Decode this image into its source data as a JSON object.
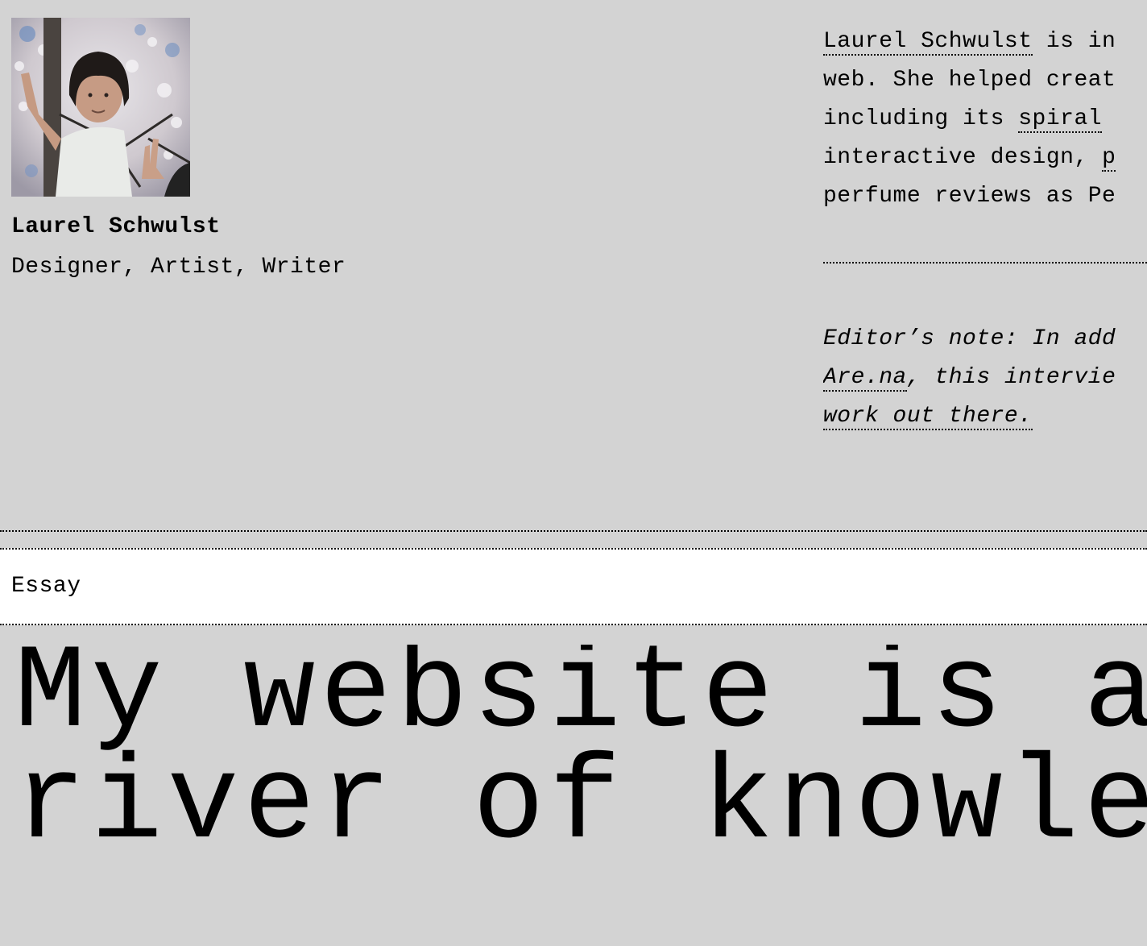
{
  "author": {
    "name": "Laurel Schwulst",
    "role": "Designer, Artist, Writer",
    "photo_alt": "Laurel Schwulst"
  },
  "bio": {
    "line1_link": "Laurel Schwulst",
    "line1_rest": " is in",
    "line2": "web. She helped creat",
    "line3_pre": "including its ",
    "line3_link": "spiral",
    "line4_pre": "interactive design, ",
    "line4_link": "p",
    "line5": "perfume reviews as Pe"
  },
  "editor_note": {
    "line1": "Editor’s note: In add",
    "line2_link": "Are.na",
    "line2_rest": ", this intervie",
    "line3_link": "work out there."
  },
  "category": {
    "label": "Essay"
  },
  "headline": {
    "line1": "My website is a sh",
    "line2": "river of knowledge"
  },
  "colors": {
    "page_background": "#d3d3d3",
    "category_background": "#ffffff",
    "text": "#000000"
  }
}
